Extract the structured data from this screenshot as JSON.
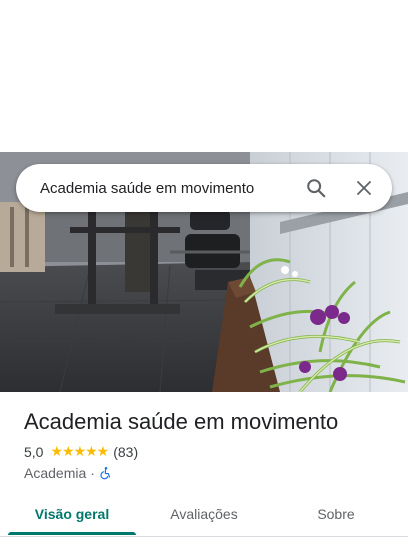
{
  "search": {
    "query": "Academia saúde em movimento"
  },
  "place": {
    "name": "Academia saúde em movimento",
    "rating": "5,0",
    "stars": "★★★★★",
    "review_count": "(83)",
    "category": "Academia",
    "separator": "·"
  },
  "tabs": [
    {
      "label": "Visão geral",
      "active": true
    },
    {
      "label": "Avaliações",
      "active": false
    },
    {
      "label": "Sobre",
      "active": false
    }
  ],
  "colors": {
    "accent": "#00796b",
    "star": "#fbbc04",
    "accessible": "#1a73e8"
  }
}
